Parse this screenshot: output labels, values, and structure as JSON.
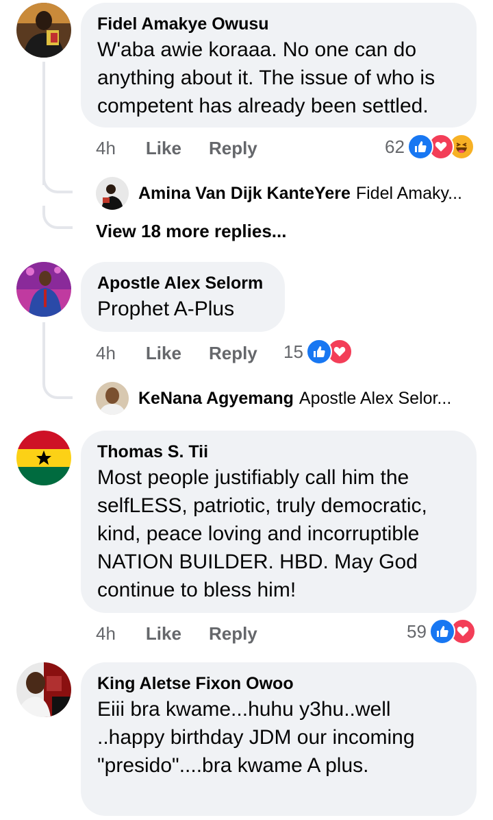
{
  "comments": [
    {
      "author": "Fidel Amakye Owusu",
      "text": "W'aba awie koraaa. No one can do anything about it. The issue of who is competent has already been settled.",
      "age": "4h",
      "like": "Like",
      "reply": "Reply",
      "reaction_count": "62",
      "reactions": [
        "like",
        "love",
        "haha"
      ],
      "replies": [
        {
          "author": "Amina Van Dijk KanteYere",
          "snippet": "Fidel Amaky..."
        }
      ],
      "more_replies": "View 18 more replies..."
    },
    {
      "author": "Apostle Alex Selorm",
      "text": "Prophet A-Plus",
      "age": "4h",
      "like": "Like",
      "reply": "Reply",
      "reaction_count": "15",
      "reactions": [
        "like",
        "love"
      ],
      "replies": [
        {
          "author": "KeNana Agyemang",
          "snippet": "Apostle Alex Selor..."
        }
      ]
    },
    {
      "author": "Thomas S. Tii",
      "text": "Most people justifiably call him the selfLESS, patriotic, truly democratic, kind, peace loving and incorruptible NATION BUILDER. HBD. May God continue to bless him!",
      "age": "4h",
      "like": "Like",
      "reply": "Reply",
      "reaction_count": "59",
      "reactions": [
        "like",
        "love"
      ]
    },
    {
      "author": "King Aletse Fixon Owoo",
      "text": "Eiii bra kwame...huhu y3hu..well ..happy birthday JDM our incoming \"presido\"....bra kwame A plus."
    }
  ],
  "colors": {
    "like": "#1877f2",
    "love": "#f33e58",
    "haha": "#f7b125",
    "bubble": "#f0f2f5",
    "muted": "#65676b",
    "thread": "#e4e6eb"
  }
}
